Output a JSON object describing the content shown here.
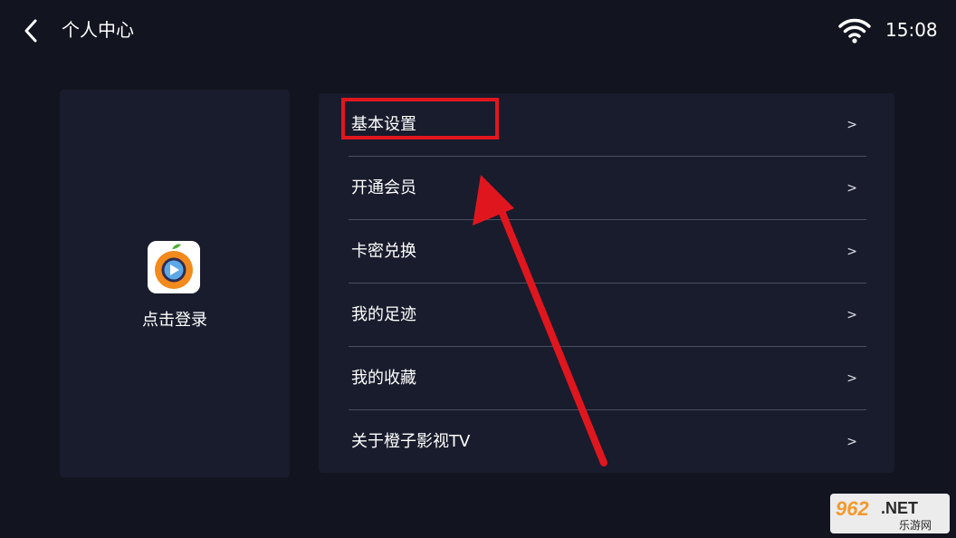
{
  "header": {
    "title": "个人中心",
    "time": "15:08"
  },
  "icons": {
    "back": "chevron-left-icon",
    "wifi": "wifi-icon",
    "app_logo": "orange-play-logo",
    "arrow": "red-pointer-arrow"
  },
  "profile": {
    "login_label": "点击登录"
  },
  "menu": {
    "items": [
      {
        "label": "基本设置",
        "chevron": ">"
      },
      {
        "label": "开通会员",
        "chevron": ">"
      },
      {
        "label": "卡密兑换",
        "chevron": ">"
      },
      {
        "label": "我的足迹",
        "chevron": ">"
      },
      {
        "label": "我的收藏",
        "chevron": ">"
      },
      {
        "label": "关于橙子影视TV",
        "chevron": ">"
      }
    ]
  },
  "annotation": {
    "highlight_color": "#e0161f"
  },
  "watermark": {
    "brand": "962",
    "suffix": ".NET",
    "subtitle": "乐游网"
  },
  "colors": {
    "background": "#12141f",
    "card": "#191c2c",
    "divider": "#4b4e5e",
    "accent_orange": "#f28a1c"
  }
}
